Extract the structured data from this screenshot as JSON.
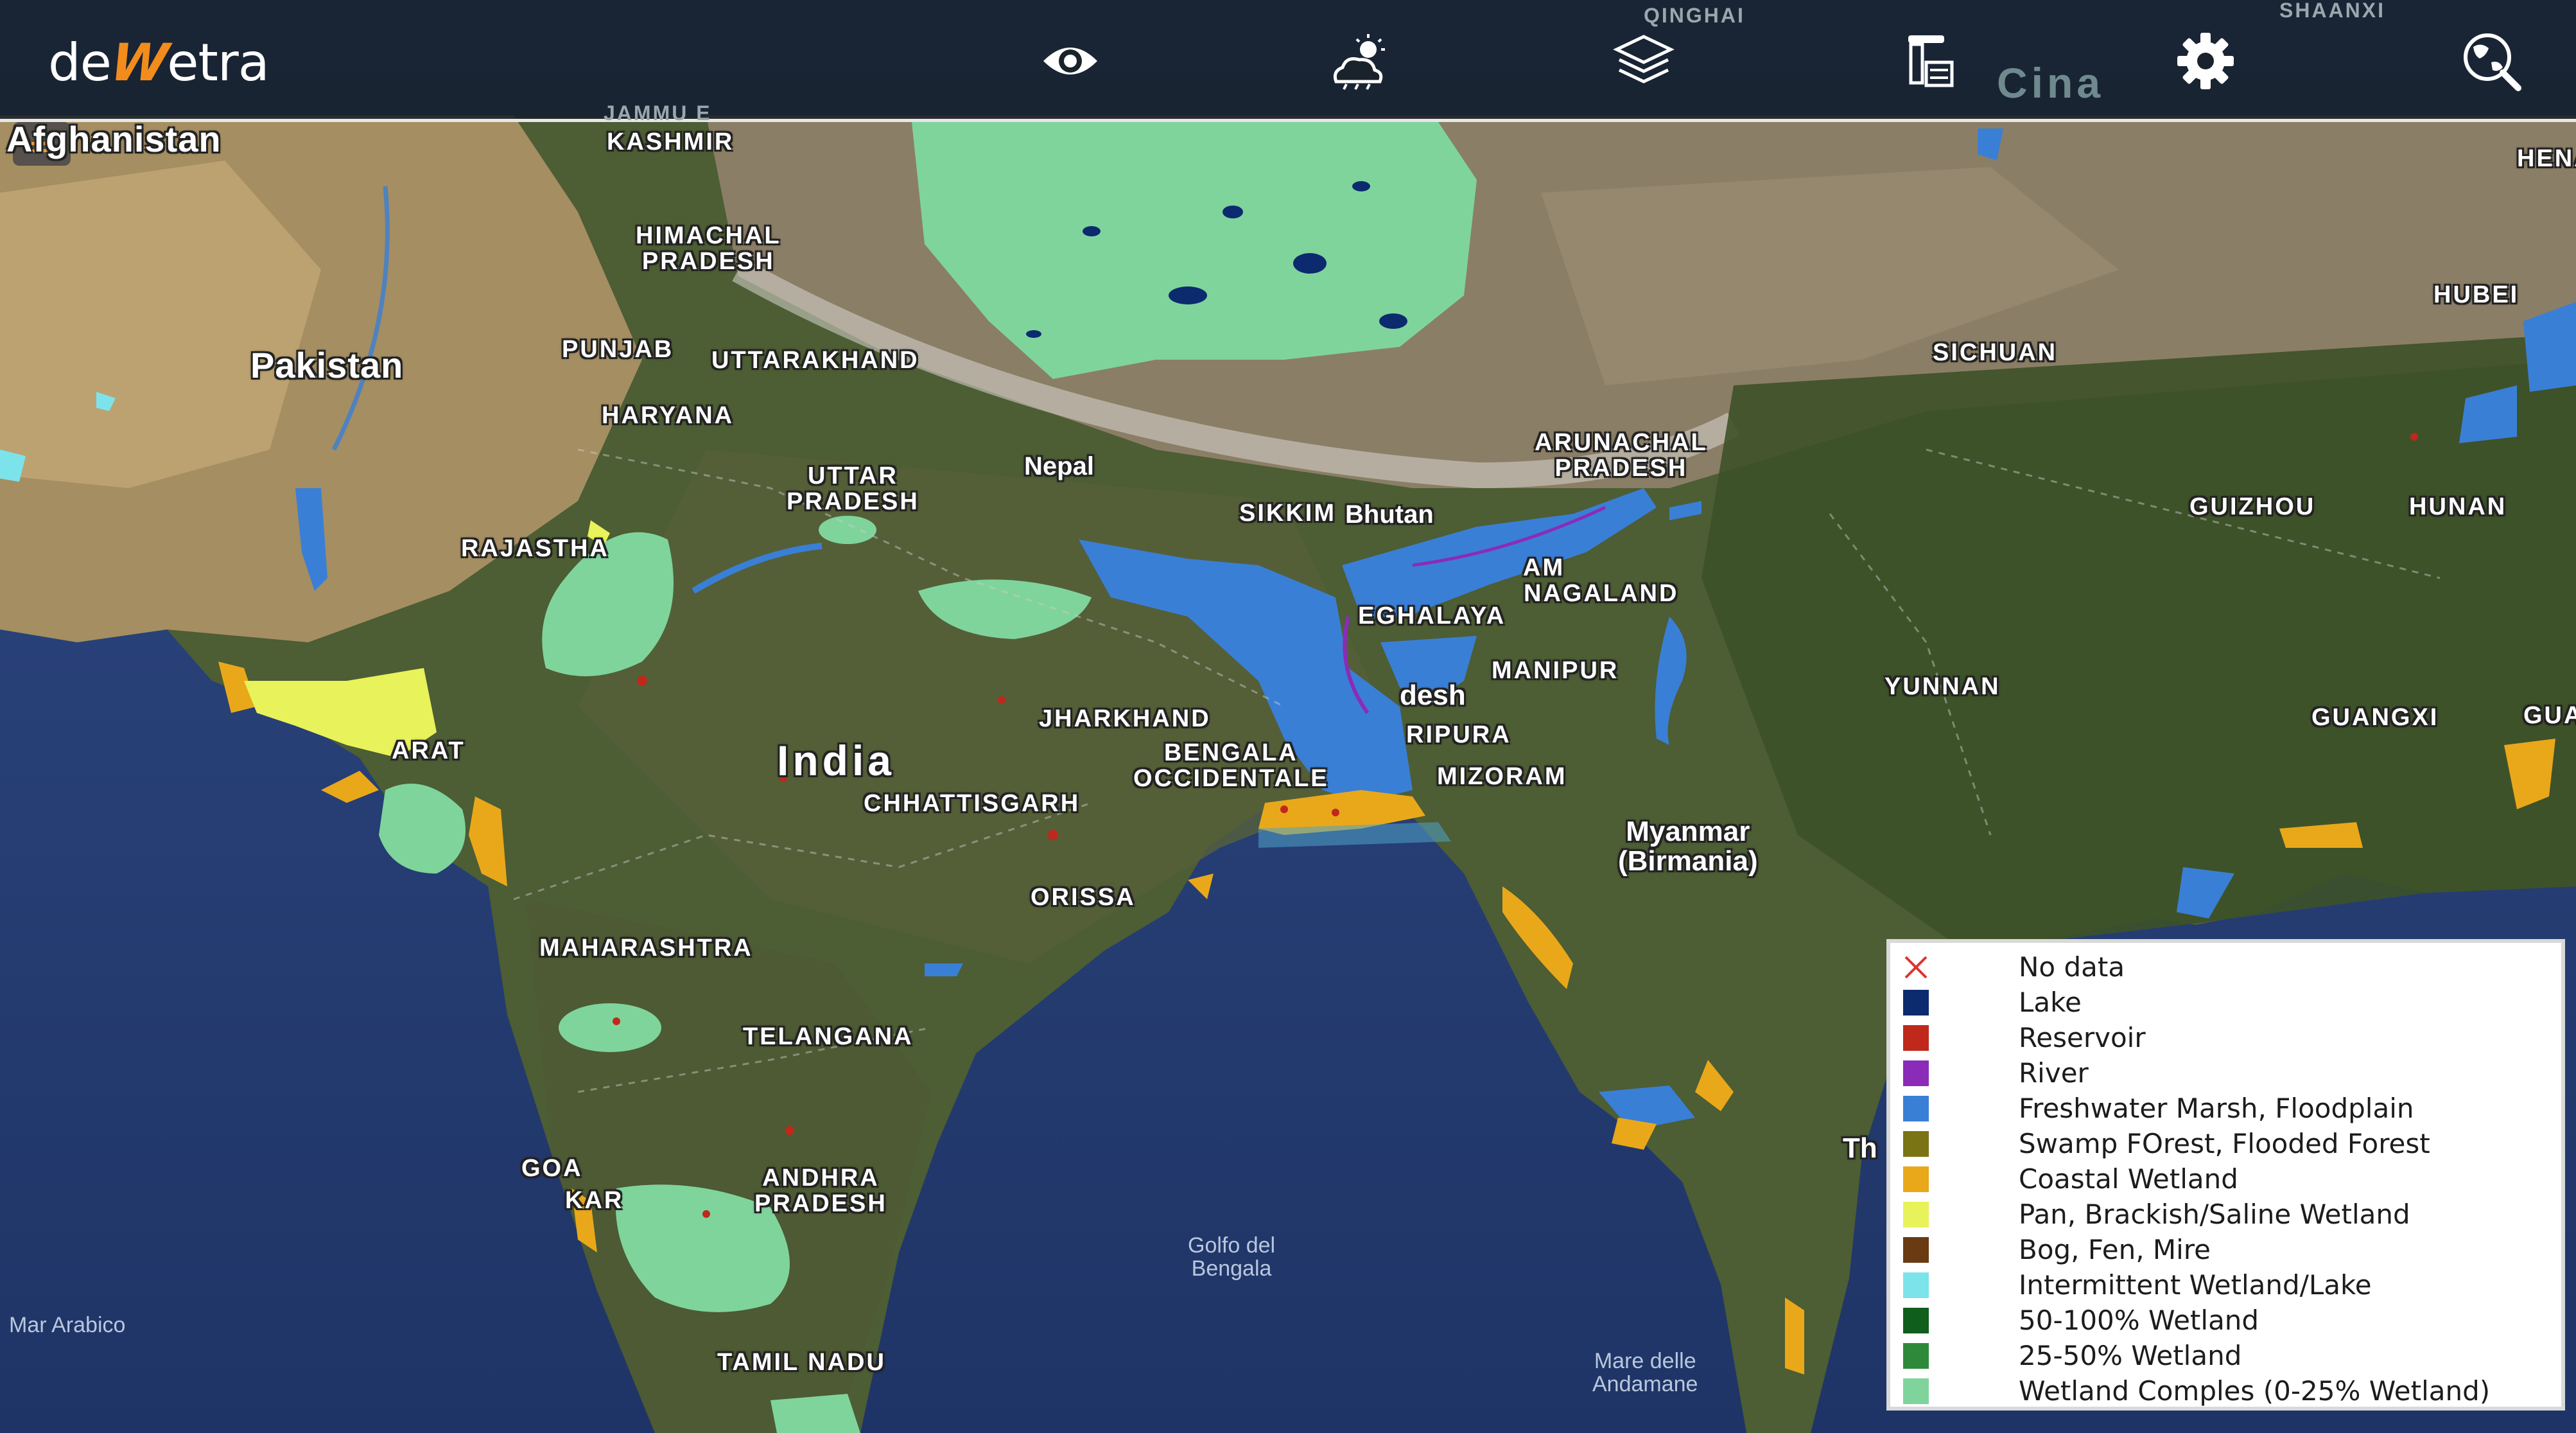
{
  "app": {
    "logo_pre": "de",
    "logo_w": "W",
    "logo_post": "etra"
  },
  "toolbar": {
    "buttons": [
      {
        "id": "view",
        "icon": "eye-icon"
      },
      {
        "id": "weather",
        "icon": "cloud-sun-icon"
      },
      {
        "id": "layers",
        "icon": "layers-icon"
      },
      {
        "id": "documents",
        "icon": "document-stack-icon"
      },
      {
        "id": "settings",
        "icon": "gear-icon"
      },
      {
        "id": "globe",
        "icon": "globe-search-icon"
      }
    ]
  },
  "map": {
    "labels": {
      "afghanistan": "Afghanistan",
      "kashmir": "KASHMIR",
      "jammu": "JAMMU E",
      "qinghai": "QINGHAI",
      "shaanxi": "SHAANXI",
      "cina": "Cina",
      "henan": "HENA",
      "himachal": "HIMACHAL\nPRADESH",
      "pakistan": "Pakistan",
      "punjab": "PUNJAB",
      "uttarakhand": "UTTARAKHAND",
      "haryana": "HARYANA",
      "hubei": "HUBEI",
      "sichuan": "SICHUAN",
      "uttar": "UTTAR\nPRADESH",
      "nepal": "Nepal",
      "arunachal": "ARUNACHAL\nPRADESH",
      "rajasthan": "RAJASTHA",
      "sikkim": "SIKKIM",
      "bhutan": "Bhutan",
      "guizhou": "GUIZHOU",
      "hunan": "HUNAN",
      "assam": "AM",
      "nagaland": "NAGALAND",
      "meghalaya": "EGHALAYA",
      "manipur": "MANIPUR",
      "bangladesh": "desh",
      "yunnan": "YUNNAN",
      "jharkhand": "JHARKHAND",
      "tripura": "RIPURA",
      "guangxi": "GUANGXI",
      "guangdong": "GUA",
      "gujarat": "ARAT",
      "india": "India",
      "bengala": "BENGALA\nOCCIDENTALE",
      "mizoram": "MIZORAM",
      "chhattisgarh": "CHHATTISGARH",
      "myanmar": "Myanmar\n(Birmania)",
      "orissa": "ORISSA",
      "maharashtra": "MAHARASHTRA",
      "telangana": "TELANGANA",
      "goa": "GOA",
      "karnataka": "KAR",
      "andhra": "ANDHRA\nPRADESH",
      "thailand": "Th",
      "golfo": "Golfo del\nBengala",
      "mar_arabico": "Mar Arabico",
      "tamil": "TAMIL NADU",
      "andamane": "Mare delle\nAndamane"
    }
  },
  "legend": {
    "items": [
      {
        "label": "No data",
        "color": "nodata"
      },
      {
        "label": "Lake",
        "color": "#0c2a6e"
      },
      {
        "label": "Reservoir",
        "color": "#c0281c"
      },
      {
        "label": "River",
        "color": "#8a2cb8"
      },
      {
        "label": "Freshwater Marsh, Floodplain",
        "color": "#3a7fd6"
      },
      {
        "label": "Swamp FOrest, Flooded Forest",
        "color": "#7a7414"
      },
      {
        "label": "Coastal Wetland",
        "color": "#e9a81a"
      },
      {
        "label": "Pan, Brackish/Saline Wetland",
        "color": "#e8f25a"
      },
      {
        "label": "Bog, Fen, Mire",
        "color": "#6a3a12"
      },
      {
        "label": "Intermittent Wetland/Lake",
        "color": "#7de3ea"
      },
      {
        "label": "50-100% Wetland",
        "color": "#0f5e1c"
      },
      {
        "label": "25-50% Wetland",
        "color": "#2e8a3a"
      },
      {
        "label": "Wetland Comples (0-25% Wetland)",
        "color": "#7fd49c"
      }
    ]
  }
}
